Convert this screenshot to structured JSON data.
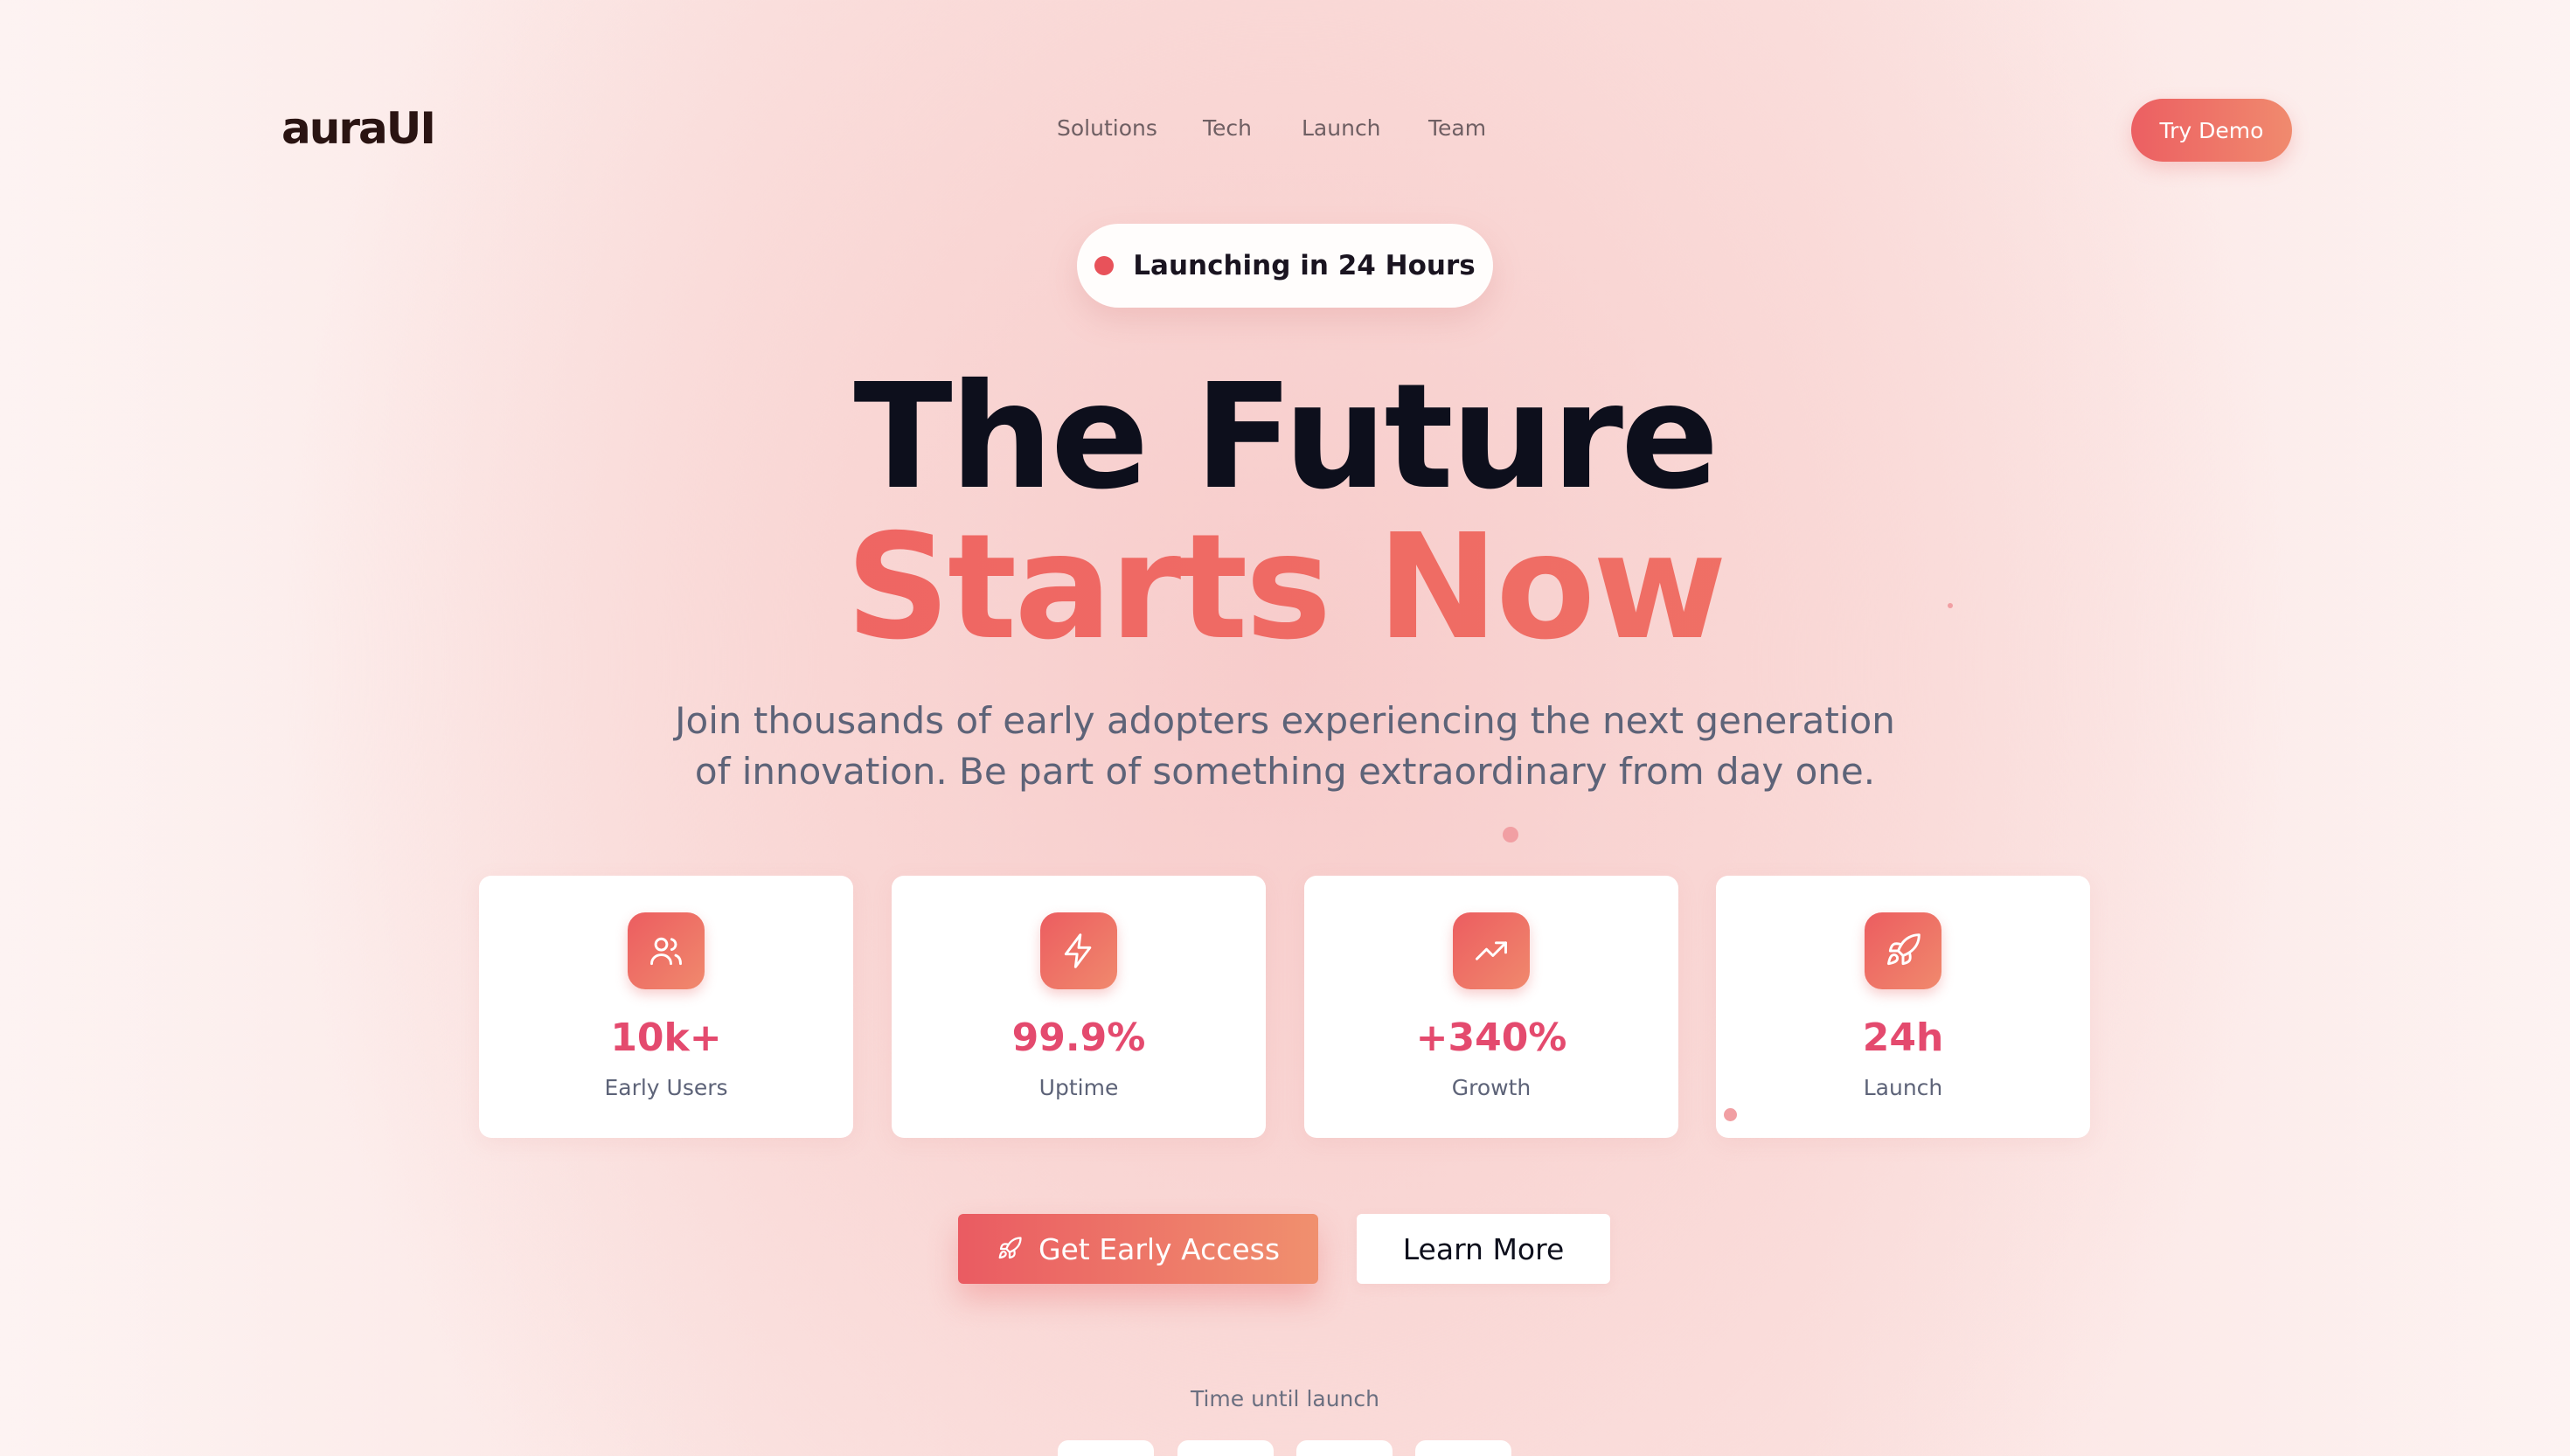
{
  "brand": {
    "logo": "auraUI"
  },
  "nav": {
    "links": [
      "Solutions",
      "Tech",
      "Launch",
      "Team"
    ],
    "cta": "Try Demo"
  },
  "hero": {
    "badge": "Launching in 24 Hours",
    "title_line1": "The Future",
    "title_line2": "Starts Now",
    "subtitle_line1": "Join thousands of early adopters experiencing the next generation",
    "subtitle_line2": "of innovation. Be part of something extraordinary from day one."
  },
  "stats": [
    {
      "icon": "users-icon",
      "value": "10k+",
      "label": "Early Users"
    },
    {
      "icon": "zap-icon",
      "value": "99.9%",
      "label": "Uptime"
    },
    {
      "icon": "trending-up-icon",
      "value": "+340%",
      "label": "Growth"
    },
    {
      "icon": "rocket-icon",
      "value": "24h",
      "label": "Launch"
    }
  ],
  "actions": {
    "primary": "Get Early Access",
    "secondary": "Learn More"
  },
  "countdown": {
    "label": "Time until launch"
  },
  "colors": {
    "accent_start": "#ec5d60",
    "accent_end": "#f0896d",
    "stat_value": "#e44a6e",
    "heading": "#0d0f1c",
    "body_text": "#5d6378"
  }
}
